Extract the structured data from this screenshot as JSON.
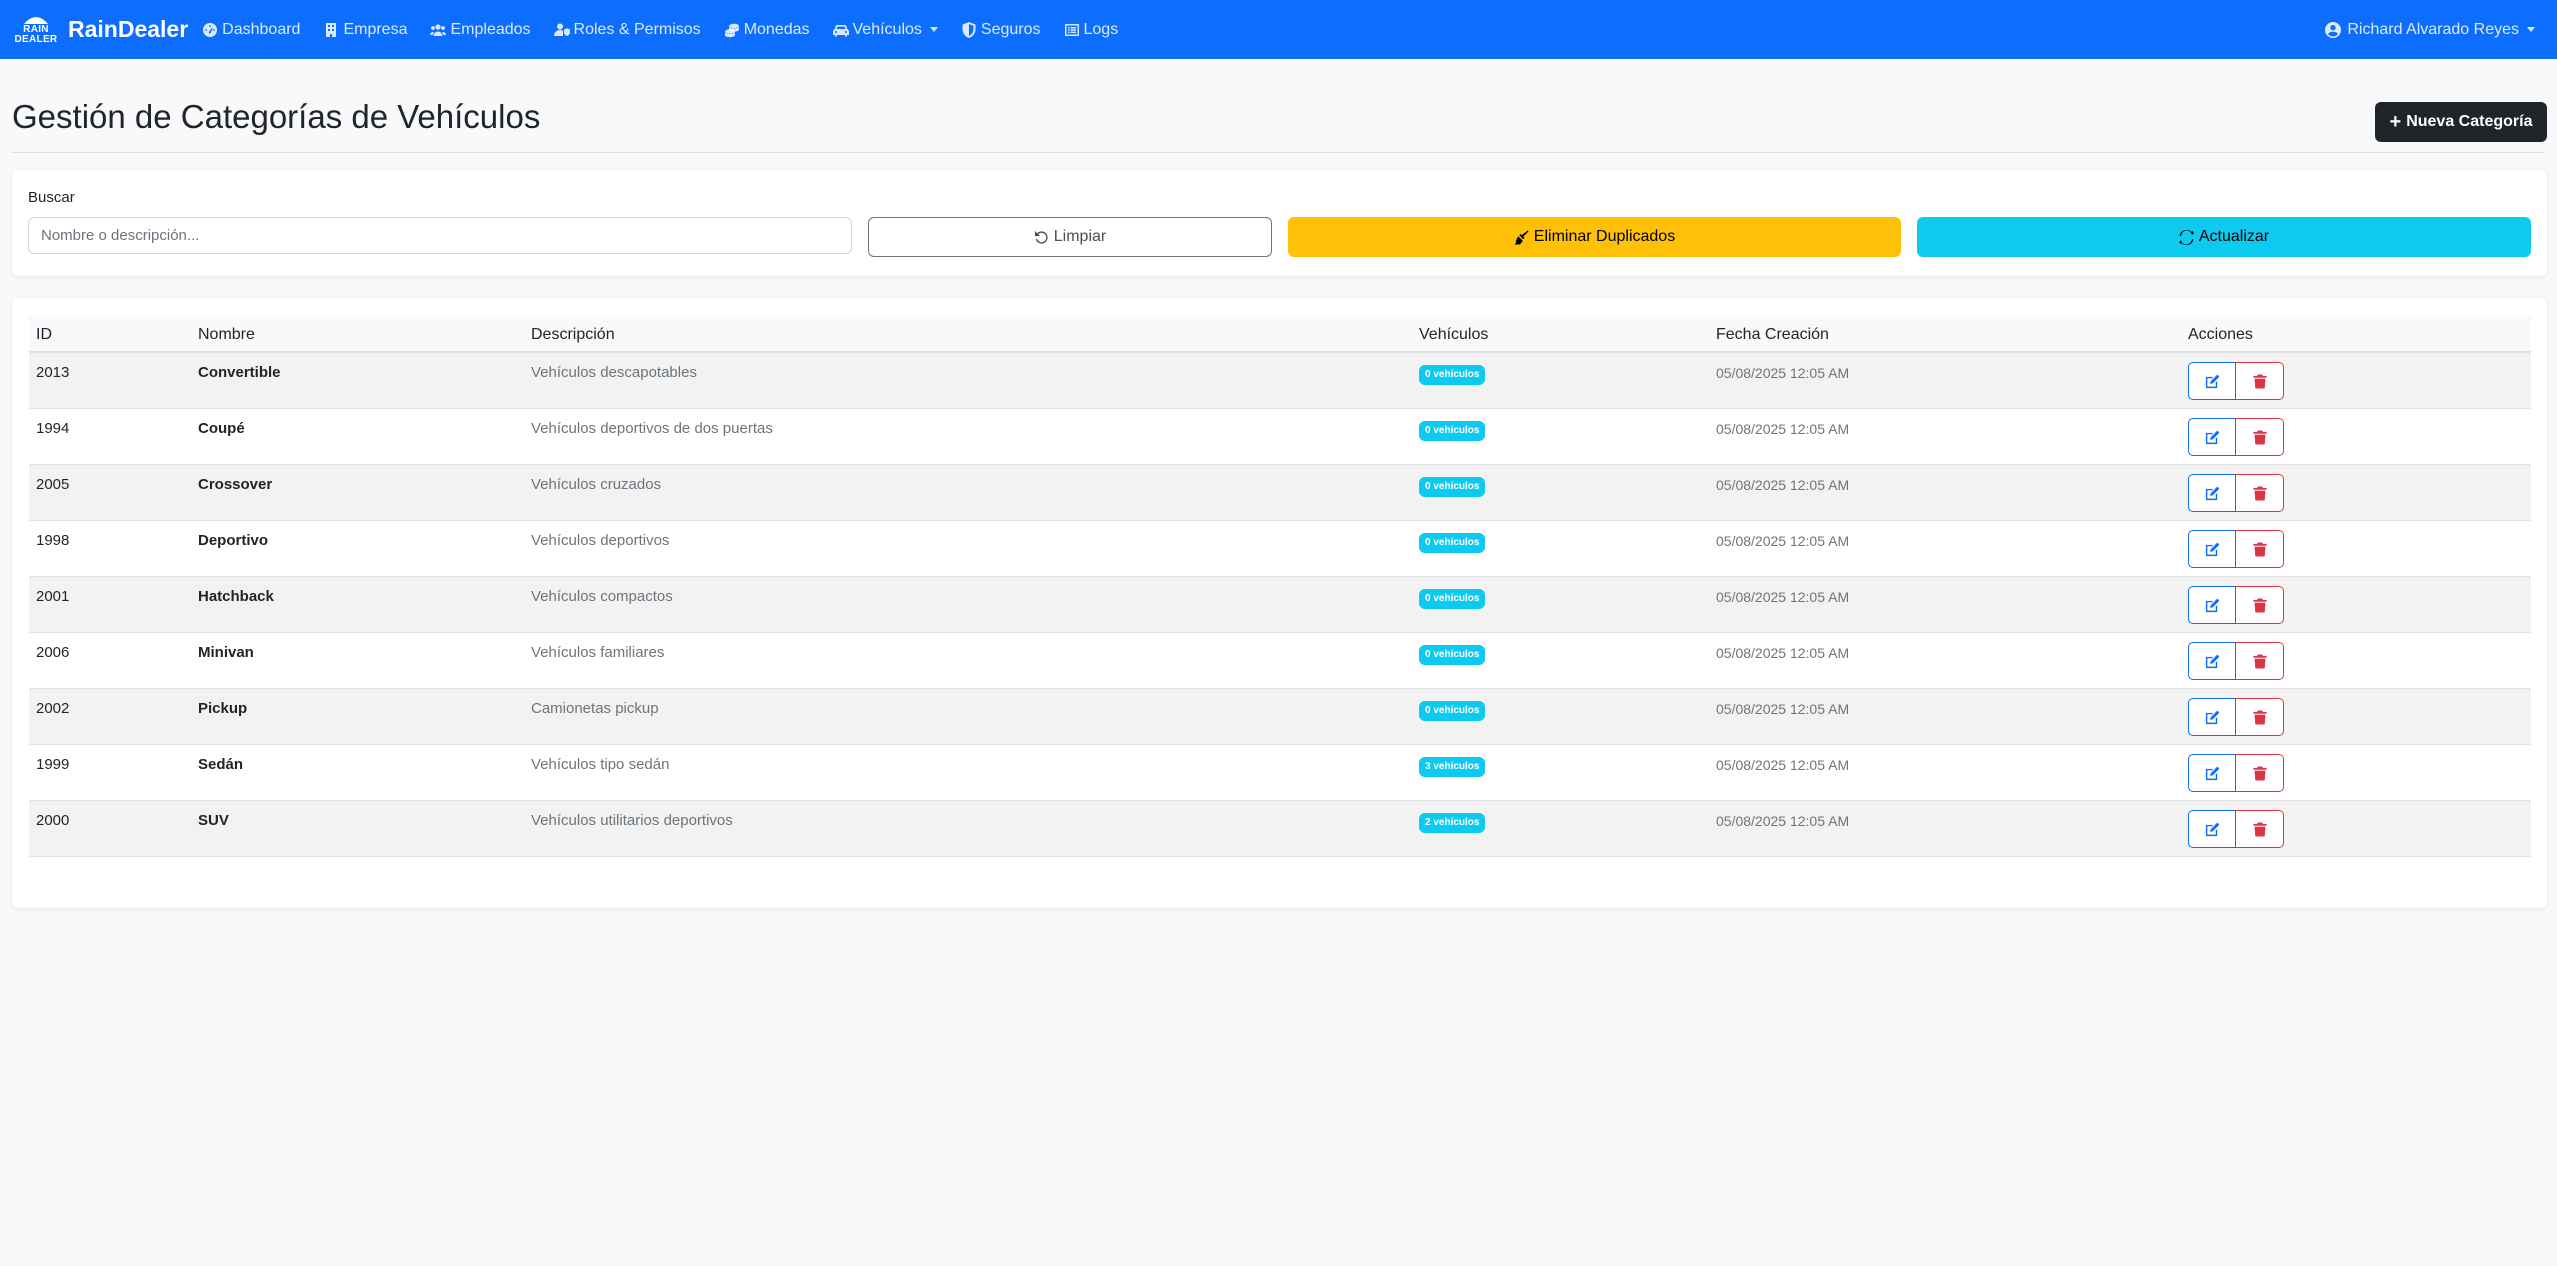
{
  "navbar": {
    "logo_line1": "RAIN",
    "logo_line2": "DEALER",
    "brand": "RainDealer",
    "links": [
      {
        "label": "Dashboard",
        "icon": "gauge-icon"
      },
      {
        "label": "Empresa",
        "icon": "building-icon"
      },
      {
        "label": "Empleados",
        "icon": "users-icon"
      },
      {
        "label": "Roles & Permisos",
        "icon": "user-shield-icon"
      },
      {
        "label": "Monedas",
        "icon": "coins-icon"
      },
      {
        "label": "Vehículos",
        "icon": "car-icon",
        "dropdown": true
      },
      {
        "label": "Seguros",
        "icon": "shield-icon"
      },
      {
        "label": "Logs",
        "icon": "list-alt-icon"
      }
    ],
    "user": "Richard Alvarado Reyes"
  },
  "header": {
    "title": "Gestión de Categorías de Vehículos",
    "new_button": "Nueva Categoría"
  },
  "search": {
    "label": "Buscar",
    "placeholder": "Nombre o descripción...",
    "value": "",
    "clear_button": "Limpiar",
    "dedupe_button": "Eliminar Duplicados",
    "refresh_button": "Actualizar"
  },
  "table": {
    "columns": [
      "ID",
      "Nombre",
      "Descripción",
      "Vehículos",
      "Fecha Creación",
      "Acciones"
    ],
    "rows": [
      {
        "id": "2013",
        "name": "Convertible",
        "description": "Vehículos descapotables",
        "vehicles": "0 vehículos",
        "created": "05/08/2025 12:05 AM"
      },
      {
        "id": "1994",
        "name": "Coupé",
        "description": "Vehículos deportivos de dos puertas",
        "vehicles": "0 vehículos",
        "created": "05/08/2025 12:05 AM"
      },
      {
        "id": "2005",
        "name": "Crossover",
        "description": "Vehículos cruzados",
        "vehicles": "0 vehículos",
        "created": "05/08/2025 12:05 AM"
      },
      {
        "id": "1998",
        "name": "Deportivo",
        "description": "Vehículos deportivos",
        "vehicles": "0 vehículos",
        "created": "05/08/2025 12:05 AM"
      },
      {
        "id": "2001",
        "name": "Hatchback",
        "description": "Vehículos compactos",
        "vehicles": "0 vehículos",
        "created": "05/08/2025 12:05 AM"
      },
      {
        "id": "2006",
        "name": "Minivan",
        "description": "Vehículos familiares",
        "vehicles": "0 vehículos",
        "created": "05/08/2025 12:05 AM"
      },
      {
        "id": "2002",
        "name": "Pickup",
        "description": "Camionetas pickup",
        "vehicles": "0 vehículos",
        "created": "05/08/2025 12:05 AM"
      },
      {
        "id": "1999",
        "name": "Sedán",
        "description": "Vehículos tipo sedán",
        "vehicles": "3 vehículos",
        "created": "05/08/2025 12:05 AM"
      },
      {
        "id": "2000",
        "name": "SUV",
        "description": "Vehículos utilitarios deportivos",
        "vehicles": "2 vehículos",
        "created": "05/08/2025 12:05 AM"
      }
    ]
  },
  "colors": {
    "primary": "#0d6efd",
    "warning": "#ffc107",
    "info": "#0dcaf0",
    "danger": "#dc3545",
    "dark": "#212529"
  }
}
